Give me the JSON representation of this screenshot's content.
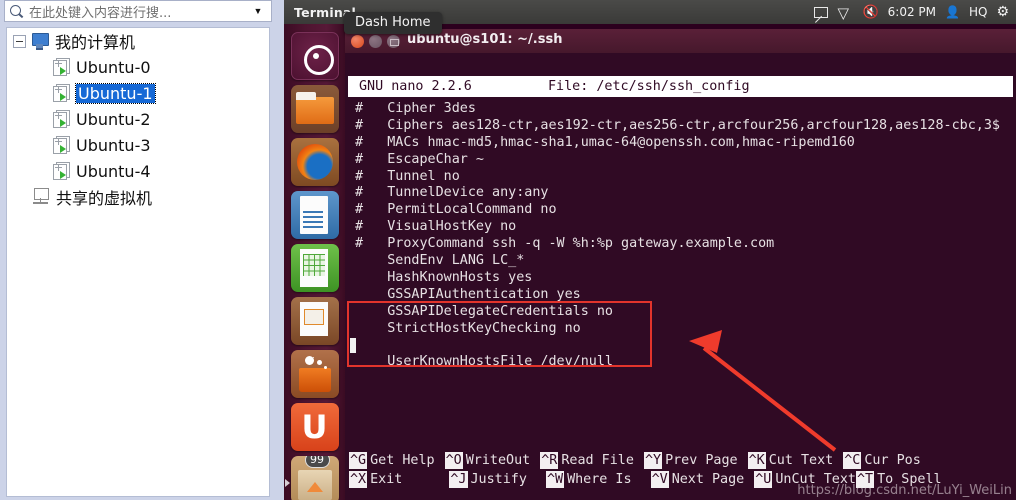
{
  "vmware": {
    "search": {
      "placeholder": "在此处键入内容进行搜...",
      "icon": "search-icon",
      "dropdown_caret": "▼"
    },
    "tree": {
      "root": {
        "label": "我的计算机",
        "icon": "computer-icon",
        "expander": "collapse-minus"
      },
      "vms": [
        {
          "label": "Ubuntu-0",
          "icon": "virtual-machine-icon",
          "selected": false
        },
        {
          "label": "Ubuntu-1",
          "icon": "virtual-machine-icon",
          "selected": true
        },
        {
          "label": "Ubuntu-2",
          "icon": "virtual-machine-icon",
          "selected": false
        },
        {
          "label": "Ubuntu-3",
          "icon": "virtual-machine-icon",
          "selected": false
        },
        {
          "label": "Ubuntu-4",
          "icon": "virtual-machine-icon",
          "selected": false
        }
      ],
      "shared": {
        "label": "共享的虚拟机",
        "icon": "shared-vm-icon"
      }
    }
  },
  "ubuntu": {
    "top_panel": {
      "title": "Terminal",
      "tray": {
        "mail_icon": "mail-icon",
        "network_icon": "wifi-icon",
        "volume_icon": "volume-muted-icon",
        "clock": "6:02 PM",
        "user_icon": "user-icon",
        "user_name": "HQ",
        "settings_icon": "gear-icon"
      }
    },
    "launcher": {
      "tooltip": "Dash Home",
      "items": [
        {
          "name": "dash-home",
          "icon": "ubuntu-logo-icon"
        },
        {
          "name": "files",
          "icon": "file-manager-icon"
        },
        {
          "name": "firefox",
          "icon": "firefox-icon"
        },
        {
          "name": "libreoffice-writer",
          "icon": "writer-document-icon"
        },
        {
          "name": "libreoffice-calc",
          "icon": "calc-spreadsheet-icon"
        },
        {
          "name": "libreoffice-impress",
          "icon": "impress-presentation-icon"
        },
        {
          "name": "software-center",
          "icon": "shopping-bag-icon"
        },
        {
          "name": "ubuntu-one",
          "icon": "letter-u-icon"
        },
        {
          "name": "trash",
          "icon": "trash-icon",
          "badge": "99"
        }
      ]
    },
    "terminal": {
      "window_title": "ubuntu@s101: ~/.ssh",
      "buttons": {
        "close": "close-button",
        "minimize": "minimize-button",
        "maximize": "maximize-button"
      }
    },
    "nano": {
      "version_label": "GNU nano 2.2.6",
      "file_label": "File: /etc/ssh/ssh_config",
      "lines": [
        "#   Cipher 3des",
        "#   Ciphers aes128-ctr,aes192-ctr,aes256-ctr,arcfour256,arcfour128,aes128-cbc,3$",
        "#   MACs hmac-md5,hmac-sha1,umac-64@openssh.com,hmac-ripemd160",
        "#   EscapeChar ~",
        "#   Tunnel no",
        "#   TunnelDevice any:any",
        "#   PermitLocalCommand no",
        "#   VisualHostKey no",
        "#   ProxyCommand ssh -q -W %h:%p gateway.example.com",
        "    SendEnv LANG LC_*",
        "    HashKnownHosts yes",
        "    GSSAPIAuthentication yes",
        "    GSSAPIDelegateCredentials no",
        "    StrictHostKeyChecking no",
        "",
        "    UserKnownHostsFile /dev/null"
      ],
      "shortcuts_row1": [
        {
          "key": "^G",
          "label": "Get Help"
        },
        {
          "key": "^O",
          "label": "WriteOut"
        },
        {
          "key": "^R",
          "label": "Read File"
        },
        {
          "key": "^Y",
          "label": "Prev Page"
        },
        {
          "key": "^K",
          "label": "Cut Text"
        },
        {
          "key": "^C",
          "label": "Cur Pos"
        }
      ],
      "shortcuts_row2": [
        {
          "key": "^X",
          "label": "Exit"
        },
        {
          "key": "^J",
          "label": "Justify"
        },
        {
          "key": "^W",
          "label": "Where Is"
        },
        {
          "key": "^V",
          "label": "Next Page"
        },
        {
          "key": "^U",
          "label": "UnCut Text"
        },
        {
          "key": "^T",
          "label": "To Spell"
        }
      ]
    },
    "annotation": {
      "highlight_color": "#e2342c",
      "arrow_color": "#ef3b2c",
      "watermark": "https://blog.csdn.net/LuYi_WeiLin"
    }
  }
}
